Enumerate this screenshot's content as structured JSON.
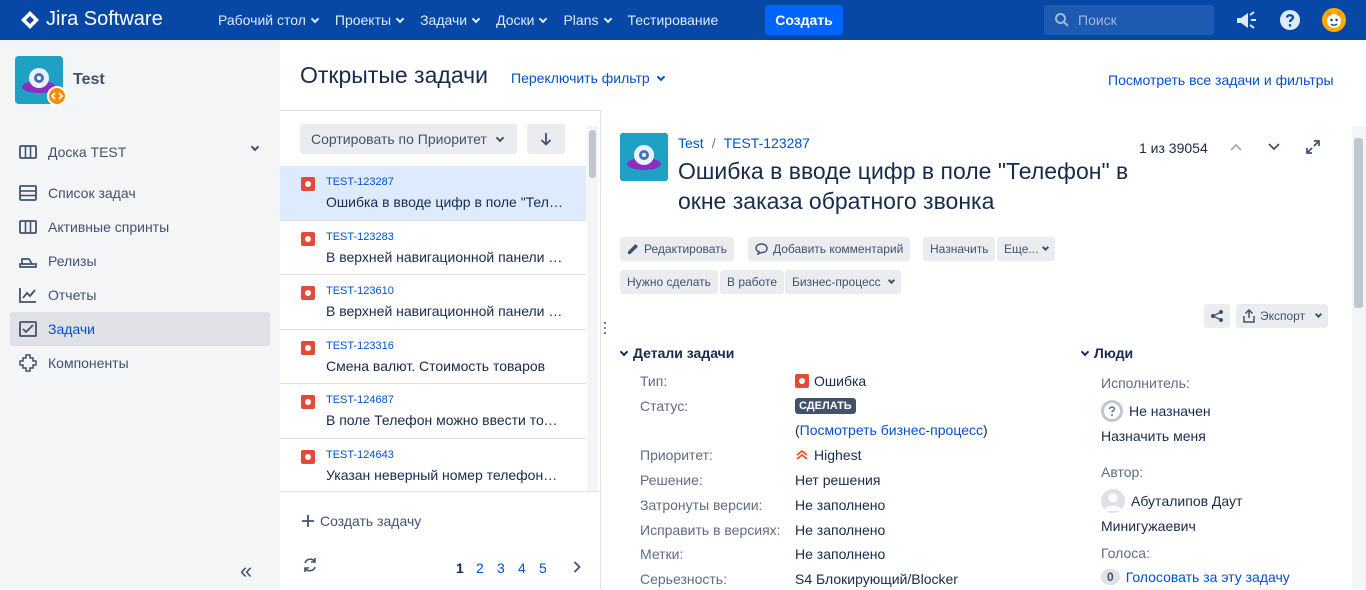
{
  "topbar": {
    "logo_text": "Jira Software",
    "nav": [
      {
        "label": "Рабочий стол",
        "dropdown": true
      },
      {
        "label": "Проекты",
        "dropdown": true
      },
      {
        "label": "Задачи",
        "dropdown": true
      },
      {
        "label": "Доски",
        "dropdown": true
      },
      {
        "label": "Plans",
        "dropdown": true
      },
      {
        "label": "Тестирование",
        "dropdown": false
      }
    ],
    "create_label": "Создать",
    "search_placeholder": "Поиск",
    "icons": [
      "megaphone-icon",
      "help-icon",
      "user-avatar"
    ],
    "colors": {
      "bar": "#0747a6",
      "create": "#0065ff"
    }
  },
  "sidebar": {
    "project_name": "Test",
    "items": [
      {
        "label": "Доска TEST",
        "icon": "board-icon",
        "dropdown": true,
        "active": false
      },
      {
        "label": "Список задач",
        "icon": "backlog-icon",
        "active": false
      },
      {
        "label": "Активные спринты",
        "icon": "sprint-icon",
        "active": false
      },
      {
        "label": "Релизы",
        "icon": "release-icon",
        "active": false
      },
      {
        "label": "Отчеты",
        "icon": "reports-icon",
        "active": false
      },
      {
        "label": "Задачи",
        "icon": "issues-icon",
        "active": true
      },
      {
        "label": "Компоненты",
        "icon": "components-icon",
        "active": false
      }
    ],
    "collapse_glyph": "«"
  },
  "header": {
    "title": "Открытые задачи",
    "switch_filter": "Переключить фильтр",
    "view_all": "Посмотреть все задачи и фильтры"
  },
  "list": {
    "sort_label": "Сортировать по Приоритет",
    "issues": [
      {
        "key": "TEST-123287",
        "summary": "Ошибка в вводе цифр в поле \"Телефон\" в окне заказа обратного звонка",
        "selected": true
      },
      {
        "key": "TEST-123283",
        "summary": "В верхней навигационной панели сайта",
        "selected": false
      },
      {
        "key": "TEST-123610",
        "summary": "В верхней навигационной панели сайта",
        "selected": false
      },
      {
        "key": "TEST-123316",
        "summary": "Смена валют. Стоимость товаров",
        "selected": false
      },
      {
        "key": "TEST-124687",
        "summary": "В поле Телефон можно ввести только цифры",
        "selected": false
      },
      {
        "key": "TEST-124643",
        "summary": "Указан неверный номер телефона в подвале",
        "selected": false
      }
    ],
    "create_issue": "Создать задачу",
    "pages": [
      "1",
      "2",
      "3",
      "4",
      "5"
    ],
    "current_page": "1"
  },
  "detail": {
    "project": "Test",
    "sep": "/",
    "key": "TEST-123287",
    "title": "Ошибка в вводе цифр в поле \"Телефон\" в окне заказа обратного звонка",
    "position": "1 из 39054",
    "toolbar": {
      "edit": "Редактировать",
      "comment": "Добавить комментарий",
      "assign": "Назначить",
      "more": "Еще...",
      "todo": "Нужно сделать",
      "in_progress": "В работе",
      "workflow": "Бизнес-процесс",
      "export": "Экспорт"
    },
    "details_title": "Детали задачи",
    "fields": {
      "type_label": "Тип:",
      "type_value": "Ошибка",
      "status_label": "Статус:",
      "status_value": "СДЕЛАТЬ",
      "workflow_link": "Посмотреть бизнес-процесс",
      "workflow_open": "(",
      "workflow_close": ")",
      "priority_label": "Приоритет:",
      "priority_value": "Highest",
      "resolution_label": "Решение:",
      "resolution_value": "Нет решения",
      "affects_label": "Затронуты версии:",
      "affects_value": "Не заполнено",
      "fix_label": "Исправить в версиях:",
      "fix_value": "Не заполнено",
      "labels_label": "Метки:",
      "labels_value": "Не заполнено",
      "severity_label": "Серьезность:",
      "severity_value": "S4 Блокирующий/Blocker"
    },
    "people_title": "Люди",
    "people": {
      "assignee_label": "Исполнитель:",
      "assignee_value": "Не назначен",
      "assign_me": "Назначить меня",
      "reporter_label": "Автор:",
      "reporter_line1": "Абутaлипов Даут",
      "reporter_line2": "Минигужаевич",
      "votes_label": "Голоса:",
      "votes_count": "0",
      "vote_link": "Голосовать за эту задачу"
    }
  }
}
